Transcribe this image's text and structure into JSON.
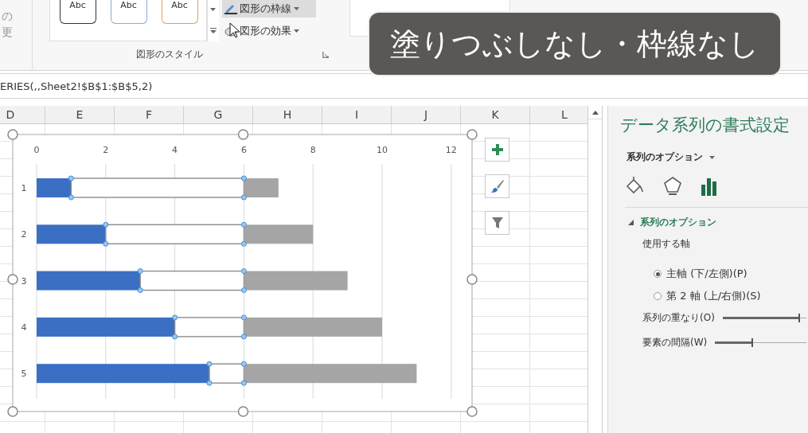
{
  "ribbon": {
    "change_shape": {
      "line_1": "の",
      "line_2": "更"
    },
    "shape_styles": [
      {
        "label": "Abc",
        "color": "#333333"
      },
      {
        "label": "Abc",
        "color": "#8ea9d8"
      },
      {
        "label": "Abc",
        "color": "#e0a060"
      }
    ],
    "shape_buttons": [
      {
        "label": "図形の枠線",
        "highlighted": true
      },
      {
        "label": "図形の効果",
        "highlighted": false
      }
    ],
    "group_label": "図形のスタイル"
  },
  "caption": "塗りつぶしなし・枠線なし",
  "formula_bar": {
    "formula": "ERIES(,,Sheet2!$B$1:$B$5,2)"
  },
  "columns": [
    "D",
    "E",
    "F",
    "G",
    "H",
    "I",
    "J",
    "K",
    "L"
  ],
  "chart": {
    "chart_data": {
      "type": "bar",
      "orientation": "horizontal",
      "stacked": true,
      "categories": [
        "1",
        "2",
        "3",
        "4",
        "5"
      ],
      "xlim": [
        0,
        12
      ],
      "xticks": [
        0,
        2,
        4,
        6,
        8,
        10,
        12
      ],
      "grid": true,
      "series": [
        {
          "color": "#3b6fc4",
          "values": [
            1,
            2,
            3,
            4,
            5
          ]
        },
        {
          "color": "#ffffff",
          "values": [
            5,
            4,
            3,
            2,
            1
          ]
        },
        {
          "color": "#a5a5a5",
          "values": [
            1,
            2,
            3,
            4,
            5
          ]
        }
      ]
    },
    "series_looks": [
      {
        "outlined": false,
        "selected": false
      },
      {
        "outlined": true,
        "selected": true
      },
      {
        "outlined": false,
        "selected": false
      }
    ]
  },
  "format_pane": {
    "title": "データ系列の書式設定",
    "options_menu": "系列のオプション",
    "icon_tabs": [
      {
        "kind": "fill",
        "selected": false
      },
      {
        "kind": "shape",
        "selected": false
      },
      {
        "kind": "options",
        "selected": true
      }
    ],
    "section": {
      "title": "系列のオプション",
      "expanded": true
    },
    "axis_label": "使用する軸",
    "axis_options": [
      {
        "label": "主軸 (下/左側)(P)",
        "selected": true
      },
      {
        "label": "第 2 軸 (上/右側)(S)",
        "selected": false
      }
    ],
    "sliders": [
      {
        "label": "系列の重なり(O)",
        "level": 0.92
      },
      {
        "label": "要素の間隔(W)",
        "level": 0.42
      }
    ]
  }
}
